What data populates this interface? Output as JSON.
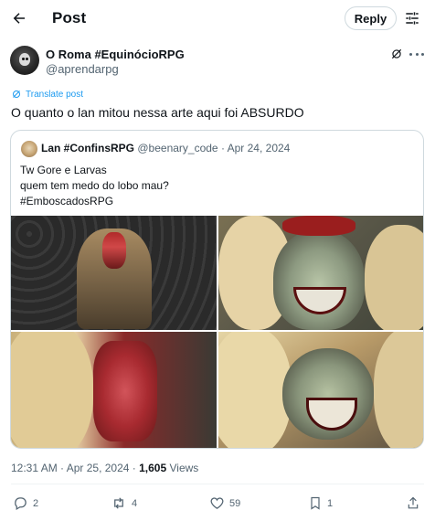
{
  "header": {
    "title": "Post",
    "reply_button": "Reply"
  },
  "author": {
    "display_name": "O Roma #EquinócioRPG",
    "handle": "@aprendarpg"
  },
  "post": {
    "translate_label": "Translate post",
    "text": "O quanto o lan mitou nessa arte aqui foi ABSURDO"
  },
  "quote": {
    "display_name": "Lan #ConfinsRPG",
    "handle": "@beenary_code",
    "separator": "·",
    "date": "Apr 24, 2024",
    "lines": [
      "Tw Gore e Larvas",
      "quem tem medo do lobo mau?",
      "#EmboscadosRPG"
    ]
  },
  "meta": {
    "time": "12:31 AM",
    "separator": "·",
    "date": "Apr 25, 2024",
    "views_count": "1,605",
    "views_label": "Views"
  },
  "actions": {
    "replies": "2",
    "reposts": "4",
    "likes": "59",
    "bookmarks": "1"
  },
  "icons": {
    "back": "arrow-left-icon",
    "tune": "tune-icon",
    "grok": "grok-icon",
    "more": "more-icon",
    "translate": "translate-icon",
    "reply": "reply-icon",
    "repost": "repost-icon",
    "like": "heart-icon",
    "bookmark": "bookmark-icon",
    "share": "share-icon"
  },
  "colors": {
    "accent": "#1d9bf0",
    "text": "#0f1419",
    "muted": "#536471",
    "border": "#cfd9de"
  }
}
